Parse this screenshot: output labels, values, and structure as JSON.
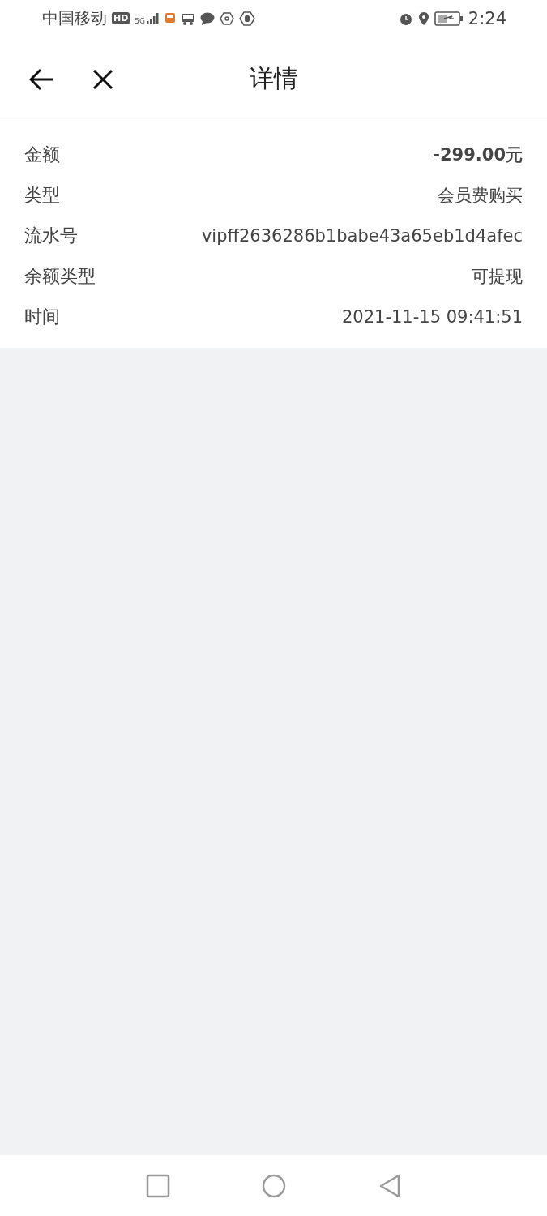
{
  "status_bar": {
    "carrier": "中国移动",
    "hd": "HD",
    "network": "5G",
    "time": "2:24"
  },
  "header": {
    "title": "详情"
  },
  "details": [
    {
      "label": "金额",
      "value": "-299.00元",
      "kind": "amount"
    },
    {
      "label": "类型",
      "value": "会员费购买",
      "kind": "text"
    },
    {
      "label": "流水号",
      "value": "vipff2636286b1babe43a65eb1d4afec",
      "kind": "text"
    },
    {
      "label": "余额类型",
      "value": "可提现",
      "kind": "text"
    },
    {
      "label": "时间",
      "value": "2021-11-15 09:41:51",
      "kind": "text"
    }
  ]
}
